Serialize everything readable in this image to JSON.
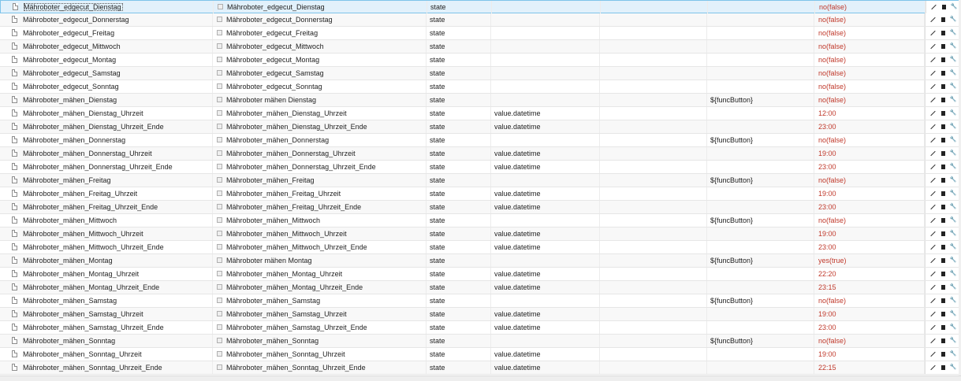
{
  "rows": [
    {
      "id": "Mähroboter_edgecut_Dienstag",
      "name": "Mähroboter_edgecut_Dienstag",
      "type": "state",
      "role": "",
      "func": "",
      "value": "no(false)",
      "selected": true
    },
    {
      "id": "Mähroboter_edgecut_Donnerstag",
      "name": "Mähroboter_edgecut_Donnerstag",
      "type": "state",
      "role": "",
      "func": "",
      "value": "no(false)"
    },
    {
      "id": "Mähroboter_edgecut_Freitag",
      "name": "Mähroboter_edgecut_Freitag",
      "type": "state",
      "role": "",
      "func": "",
      "value": "no(false)"
    },
    {
      "id": "Mähroboter_edgecut_Mittwoch",
      "name": "Mähroboter_edgecut_Mittwoch",
      "type": "state",
      "role": "",
      "func": "",
      "value": "no(false)"
    },
    {
      "id": "Mähroboter_edgecut_Montag",
      "name": "Mähroboter_edgecut_Montag",
      "type": "state",
      "role": "",
      "func": "",
      "value": "no(false)"
    },
    {
      "id": "Mähroboter_edgecut_Samstag",
      "name": "Mähroboter_edgecut_Samstag",
      "type": "state",
      "role": "",
      "func": "",
      "value": "no(false)"
    },
    {
      "id": "Mähroboter_edgecut_Sonntag",
      "name": "Mähroboter_edgecut_Sonntag",
      "type": "state",
      "role": "",
      "func": "",
      "value": "no(false)"
    },
    {
      "id": "Mähroboter_mähen_Dienstag",
      "name": "Mähroboter mähen Dienstag",
      "type": "state",
      "role": "",
      "func": "${funcButton}",
      "value": "no(false)"
    },
    {
      "id": "Mähroboter_mähen_Dienstag_Uhrzeit",
      "name": "Mähroboter_mähen_Dienstag_Uhrzeit",
      "type": "state",
      "role": "value.datetime",
      "func": "",
      "value": "12:00"
    },
    {
      "id": "Mähroboter_mähen_Dienstag_Uhrzeit_Ende",
      "name": "Mähroboter_mähen_Dienstag_Uhrzeit_Ende",
      "type": "state",
      "role": "value.datetime",
      "func": "",
      "value": "23:00"
    },
    {
      "id": "Mähroboter_mähen_Donnerstag",
      "name": "Mähroboter_mähen_Donnerstag",
      "type": "state",
      "role": "",
      "func": "${funcButton}",
      "value": "no(false)"
    },
    {
      "id": "Mähroboter_mähen_Donnerstag_Uhrzeit",
      "name": "Mähroboter_mähen_Donnerstag_Uhrzeit",
      "type": "state",
      "role": "value.datetime",
      "func": "",
      "value": "19:00"
    },
    {
      "id": "Mähroboter_mähen_Donnerstag_Uhrzeit_Ende",
      "name": "Mähroboter_mähen_Donnerstag_Uhrzeit_Ende",
      "type": "state",
      "role": "value.datetime",
      "func": "",
      "value": "23:00"
    },
    {
      "id": "Mähroboter_mähen_Freitag",
      "name": "Mähroboter_mähen_Freitag",
      "type": "state",
      "role": "",
      "func": "${funcButton}",
      "value": "no(false)"
    },
    {
      "id": "Mähroboter_mähen_Freitag_Uhrzeit",
      "name": "Mähroboter_mähen_Freitag_Uhrzeit",
      "type": "state",
      "role": "value.datetime",
      "func": "",
      "value": "19:00"
    },
    {
      "id": "Mähroboter_mähen_Freitag_Uhrzeit_Ende",
      "name": "Mähroboter_mähen_Freitag_Uhrzeit_Ende",
      "type": "state",
      "role": "value.datetime",
      "func": "",
      "value": "23:00"
    },
    {
      "id": "Mähroboter_mähen_Mittwoch",
      "name": "Mähroboter_mähen_Mittwoch",
      "type": "state",
      "role": "",
      "func": "${funcButton}",
      "value": "no(false)"
    },
    {
      "id": "Mähroboter_mähen_Mittwoch_Uhrzeit",
      "name": "Mähroboter_mähen_Mittwoch_Uhrzeit",
      "type": "state",
      "role": "value.datetime",
      "func": "",
      "value": "19:00"
    },
    {
      "id": "Mähroboter_mähen_Mittwoch_Uhrzeit_Ende",
      "name": "Mähroboter_mähen_Mittwoch_Uhrzeit_Ende",
      "type": "state",
      "role": "value.datetime",
      "func": "",
      "value": "23:00"
    },
    {
      "id": "Mähroboter_mähen_Montag",
      "name": "Mähroboter mähen Montag",
      "type": "state",
      "role": "",
      "func": "${funcButton}",
      "value": "yes(true)"
    },
    {
      "id": "Mähroboter_mähen_Montag_Uhrzeit",
      "name": "Mähroboter_mähen_Montag_Uhrzeit",
      "type": "state",
      "role": "value.datetime",
      "func": "",
      "value": "22:20"
    },
    {
      "id": "Mähroboter_mähen_Montag_Uhrzeit_Ende",
      "name": "Mähroboter_mähen_Montag_Uhrzeit_Ende",
      "type": "state",
      "role": "value.datetime",
      "func": "",
      "value": "23:15"
    },
    {
      "id": "Mähroboter_mähen_Samstag",
      "name": "Mähroboter_mähen_Samstag",
      "type": "state",
      "role": "",
      "func": "${funcButton}",
      "value": "no(false)"
    },
    {
      "id": "Mähroboter_mähen_Samstag_Uhrzeit",
      "name": "Mähroboter_mähen_Samstag_Uhrzeit",
      "type": "state",
      "role": "value.datetime",
      "func": "",
      "value": "19:00"
    },
    {
      "id": "Mähroboter_mähen_Samstag_Uhrzeit_Ende",
      "name": "Mähroboter_mähen_Samstag_Uhrzeit_Ende",
      "type": "state",
      "role": "value.datetime",
      "func": "",
      "value": "23:00"
    },
    {
      "id": "Mähroboter_mähen_Sonntag",
      "name": "Mähroboter_mähen_Sonntag",
      "type": "state",
      "role": "",
      "func": "${funcButton}",
      "value": "no(false)"
    },
    {
      "id": "Mähroboter_mähen_Sonntag_Uhrzeit",
      "name": "Mähroboter_mähen_Sonntag_Uhrzeit",
      "type": "state",
      "role": "value.datetime",
      "func": "",
      "value": "19:00"
    },
    {
      "id": "Mähroboter_mähen_Sonntag_Uhrzeit_Ende",
      "name": "Mähroboter_mähen_Sonntag_Uhrzeit_Ende",
      "type": "state",
      "role": "value.datetime",
      "func": "",
      "value": "22:15"
    }
  ],
  "actions": {
    "edit_icon": "pencil-icon",
    "delete_icon": "trash-icon",
    "settings_icon": "wrench-icon"
  },
  "colors": {
    "value_text": "#c0392b",
    "selected_row": "#e2f1fb",
    "selected_border": "#7ec4ea"
  }
}
